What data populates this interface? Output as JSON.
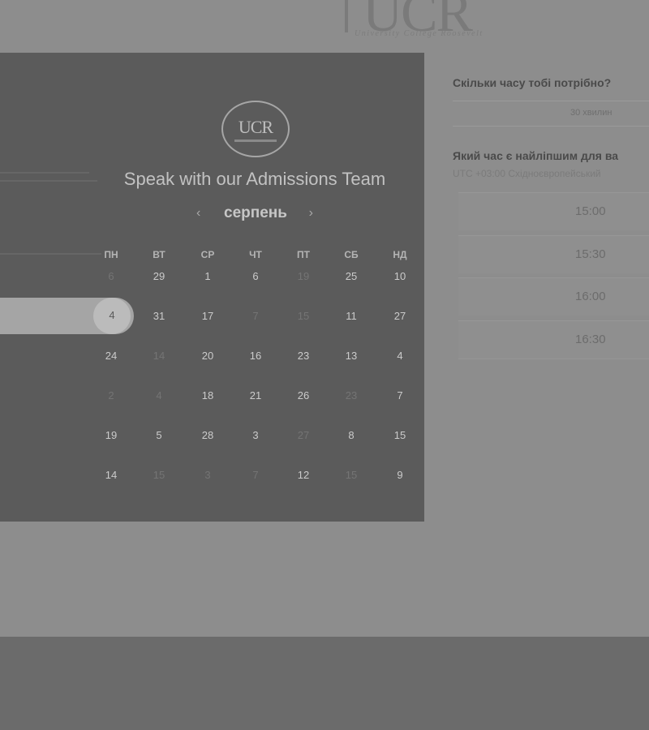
{
  "header": {
    "logo_text": "UCR",
    "logo_subtitle": "University College Roosevelt"
  },
  "calendar": {
    "logo_text": "UCR",
    "title": "Speak with our Admissions Team",
    "month": "серпень",
    "prev_icon": "chevron-left-icon",
    "next_icon": "chevron-right-icon",
    "prev_glyph": "‹",
    "next_glyph": "›",
    "weekdays": [
      "ПН",
      "ВТ",
      "СР",
      "ЧТ",
      "ПТ",
      "СБ",
      "НД"
    ],
    "weeks": [
      [
        "6",
        "29",
        "1",
        "6",
        "19",
        "25",
        "10"
      ],
      [
        "4",
        "31",
        "17",
        "7",
        "15",
        "11",
        "27"
      ],
      [
        "24",
        "14",
        "20",
        "16",
        "23",
        "13",
        "4"
      ],
      [
        "2",
        "4",
        "18",
        "21",
        "26",
        "23",
        "7"
      ],
      [
        "19",
        "5",
        "28",
        "3",
        "27",
        "8",
        "15"
      ],
      [
        "14",
        "15",
        "3",
        "7",
        "12",
        "15",
        "9"
      ]
    ],
    "selected_day": "4"
  },
  "booking": {
    "duration_question": "Скільки часу тобі потрібно?",
    "duration_value": "30 хвилин",
    "time_question": "Який час є найліпшим для ва",
    "timezone": "UTC +03:00 Східноєвропейський",
    "slots": [
      "15:00",
      "15:30",
      "16:00",
      "16:30"
    ]
  }
}
